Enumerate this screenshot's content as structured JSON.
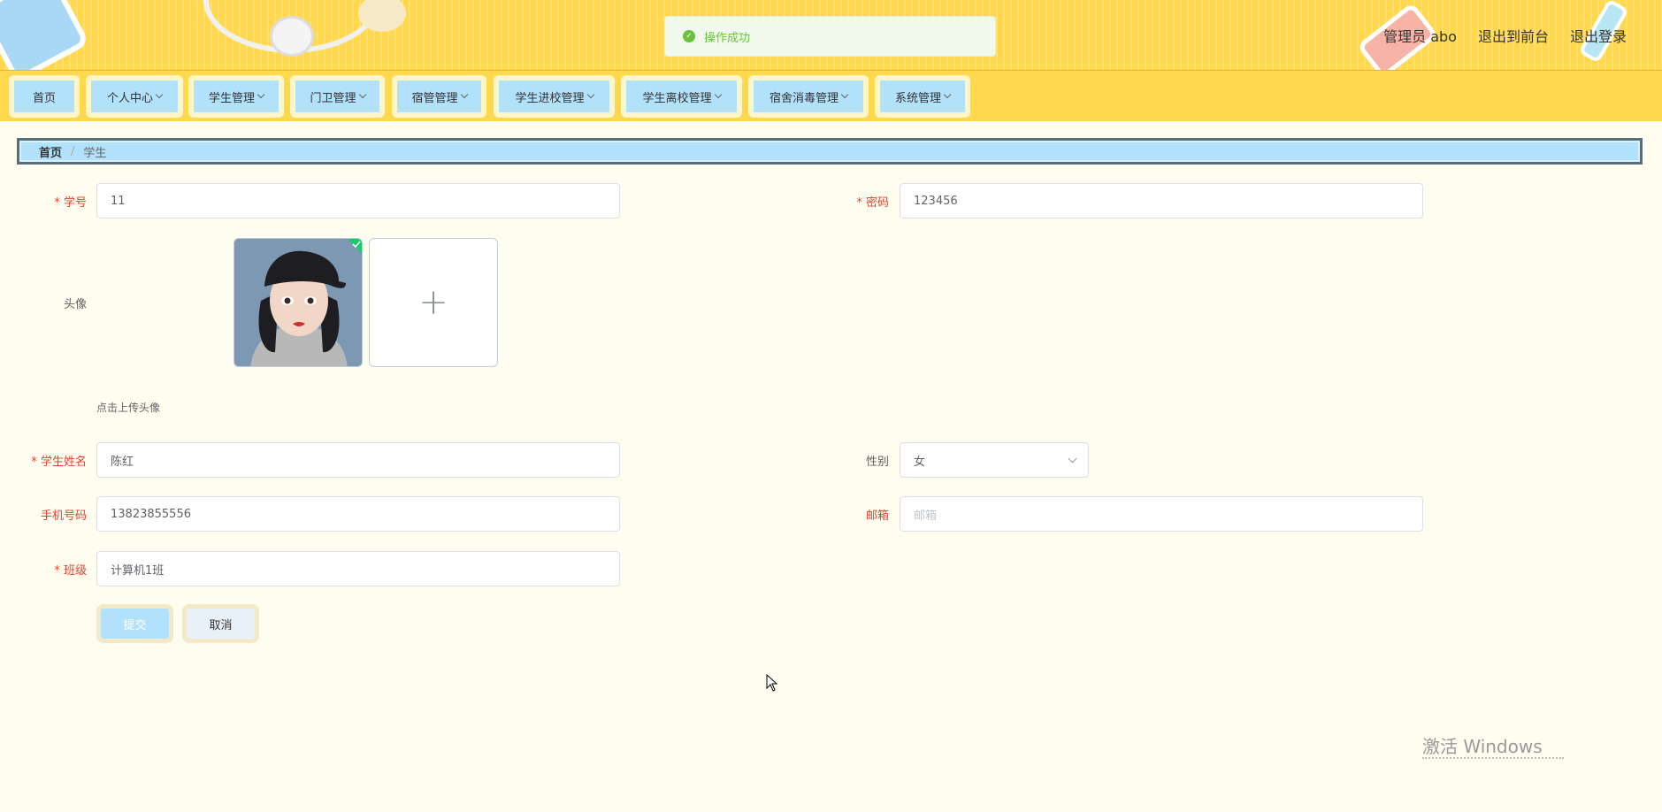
{
  "toast": {
    "message": "操作成功"
  },
  "header": {
    "user_label": "管理员 abo",
    "to_front_label": "退出到前台",
    "logout_label": "退出登录"
  },
  "nav": {
    "items": [
      {
        "label": "首页"
      },
      {
        "label": "个人中心"
      },
      {
        "label": "学生管理"
      },
      {
        "label": "门卫管理"
      },
      {
        "label": "宿管管理"
      },
      {
        "label": "学生进校管理"
      },
      {
        "label": "学生离校管理"
      },
      {
        "label": "宿舍消毒管理"
      },
      {
        "label": "系统管理"
      }
    ]
  },
  "breadcrumb": {
    "home": "首页",
    "current": "学生"
  },
  "form": {
    "student_id": {
      "label": "学号",
      "value": "11"
    },
    "password": {
      "label": "密码",
      "value": "123456"
    },
    "avatar": {
      "label": "头像",
      "hint": "点击上传头像",
      "add_symbol": "+"
    },
    "name": {
      "label": "学生姓名",
      "value": "陈红"
    },
    "gender": {
      "label": "性别",
      "value": "女"
    },
    "phone": {
      "label": "手机号码",
      "value": "13823855556"
    },
    "email": {
      "label": "邮箱",
      "placeholder": "邮箱"
    },
    "class": {
      "label": "班级",
      "value": "计算机1班"
    },
    "submit_label": "提交",
    "cancel_label": "取消"
  },
  "watermark": {
    "text": "激活 Windows"
  },
  "colors": {
    "header_bg": "#ffd84d",
    "nav_button": "#b2e1fb",
    "page_bg": "#fffdf0",
    "required": "#e4432f",
    "success": "#67c23a"
  }
}
